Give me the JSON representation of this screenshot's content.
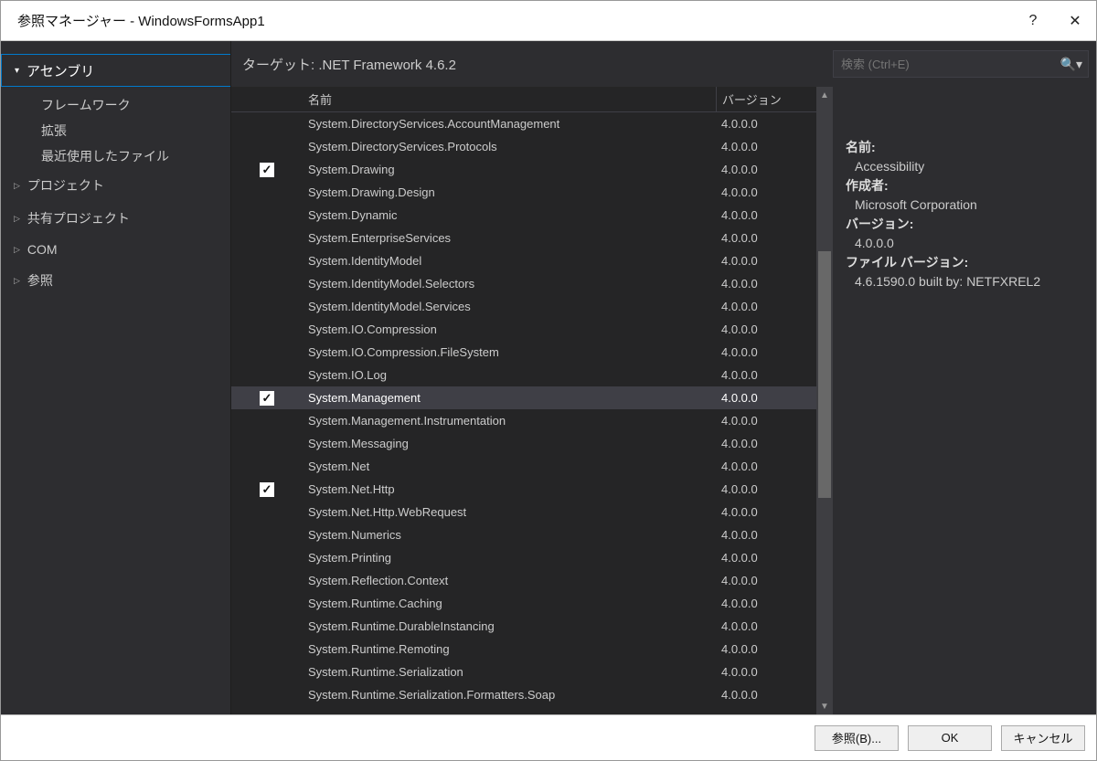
{
  "window": {
    "title": "参照マネージャー - WindowsFormsApp1",
    "help": "?",
    "close": "✕"
  },
  "sidebar": {
    "header": "アセンブリ",
    "subs": [
      "フレームワーク",
      "拡張",
      "最近使用したファイル"
    ],
    "cats": [
      "プロジェクト",
      "共有プロジェクト",
      "COM",
      "参照"
    ]
  },
  "target": "ターゲット: .NET Framework 4.6.2",
  "search": {
    "placeholder": "検索 (Ctrl+E)"
  },
  "columns": {
    "name": "名前",
    "version": "バージョン"
  },
  "rows": [
    {
      "chk": false,
      "name": "System.DirectoryServices.AccountManagement",
      "ver": "4.0.0.0"
    },
    {
      "chk": false,
      "name": "System.DirectoryServices.Protocols",
      "ver": "4.0.0.0"
    },
    {
      "chk": true,
      "name": "System.Drawing",
      "ver": "4.0.0.0"
    },
    {
      "chk": false,
      "name": "System.Drawing.Design",
      "ver": "4.0.0.0"
    },
    {
      "chk": false,
      "name": "System.Dynamic",
      "ver": "4.0.0.0"
    },
    {
      "chk": false,
      "name": "System.EnterpriseServices",
      "ver": "4.0.0.0"
    },
    {
      "chk": false,
      "name": "System.IdentityModel",
      "ver": "4.0.0.0"
    },
    {
      "chk": false,
      "name": "System.IdentityModel.Selectors",
      "ver": "4.0.0.0"
    },
    {
      "chk": false,
      "name": "System.IdentityModel.Services",
      "ver": "4.0.0.0"
    },
    {
      "chk": false,
      "name": "System.IO.Compression",
      "ver": "4.0.0.0"
    },
    {
      "chk": false,
      "name": "System.IO.Compression.FileSystem",
      "ver": "4.0.0.0"
    },
    {
      "chk": false,
      "name": "System.IO.Log",
      "ver": "4.0.0.0"
    },
    {
      "chk": true,
      "name": "System.Management",
      "ver": "4.0.0.0",
      "selected": true
    },
    {
      "chk": false,
      "name": "System.Management.Instrumentation",
      "ver": "4.0.0.0"
    },
    {
      "chk": false,
      "name": "System.Messaging",
      "ver": "4.0.0.0"
    },
    {
      "chk": false,
      "name": "System.Net",
      "ver": "4.0.0.0"
    },
    {
      "chk": true,
      "name": "System.Net.Http",
      "ver": "4.0.0.0"
    },
    {
      "chk": false,
      "name": "System.Net.Http.WebRequest",
      "ver": "4.0.0.0"
    },
    {
      "chk": false,
      "name": "System.Numerics",
      "ver": "4.0.0.0"
    },
    {
      "chk": false,
      "name": "System.Printing",
      "ver": "4.0.0.0"
    },
    {
      "chk": false,
      "name": "System.Reflection.Context",
      "ver": "4.0.0.0"
    },
    {
      "chk": false,
      "name": "System.Runtime.Caching",
      "ver": "4.0.0.0"
    },
    {
      "chk": false,
      "name": "System.Runtime.DurableInstancing",
      "ver": "4.0.0.0"
    },
    {
      "chk": false,
      "name": "System.Runtime.Remoting",
      "ver": "4.0.0.0"
    },
    {
      "chk": false,
      "name": "System.Runtime.Serialization",
      "ver": "4.0.0.0"
    },
    {
      "chk": false,
      "name": "System.Runtime.Serialization.Formatters.Soap",
      "ver": "4.0.0.0"
    }
  ],
  "details": {
    "name_label": "名前:",
    "name_value": "Accessibility",
    "author_label": "作成者:",
    "author_value": "Microsoft Corporation",
    "version_label": "バージョン:",
    "version_value": "4.0.0.0",
    "filever_label": "ファイル バージョン:",
    "filever_value": "4.6.1590.0 built by: NETFXREL2"
  },
  "footer": {
    "browse": "参照(B)...",
    "ok": "OK",
    "cancel": "キャンセル"
  }
}
